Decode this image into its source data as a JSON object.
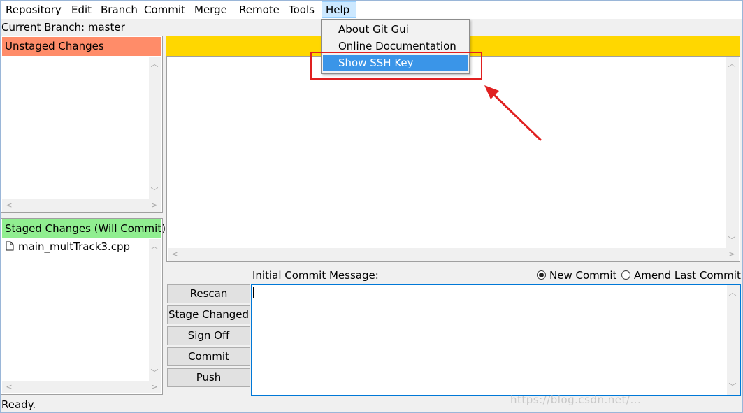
{
  "menubar": {
    "items": [
      "Repository",
      "Edit",
      "Branch",
      "Commit",
      "Merge",
      "Remote",
      "Tools",
      "Help"
    ]
  },
  "branch_label": "Current Branch: master",
  "unstaged": {
    "title": "Unstaged Changes",
    "header_color": "#ff8c69"
  },
  "staged": {
    "title": "Staged Changes (Will Commit)",
    "header_color": "#90ee90",
    "files": [
      "main_multTrack3.cpp"
    ]
  },
  "diff": {
    "header_color": "#ffd700"
  },
  "commit": {
    "message_label": "Initial Commit Message:",
    "radio_new": "New Commit",
    "radio_amend": "Amend Last Commit",
    "selected": "New Commit"
  },
  "buttons": {
    "rescan": "Rescan",
    "stage_changed": "Stage Changed",
    "sign_off": "Sign Off",
    "commit": "Commit",
    "push": "Push"
  },
  "help_menu": {
    "items": [
      "About Git Gui",
      "Online Documentation",
      "Show SSH Key"
    ],
    "highlighted": "Show SSH Key"
  },
  "status": "Ready.",
  "watermark": "https://blog.csdn.net/...",
  "annotation_color": "#e02020"
}
